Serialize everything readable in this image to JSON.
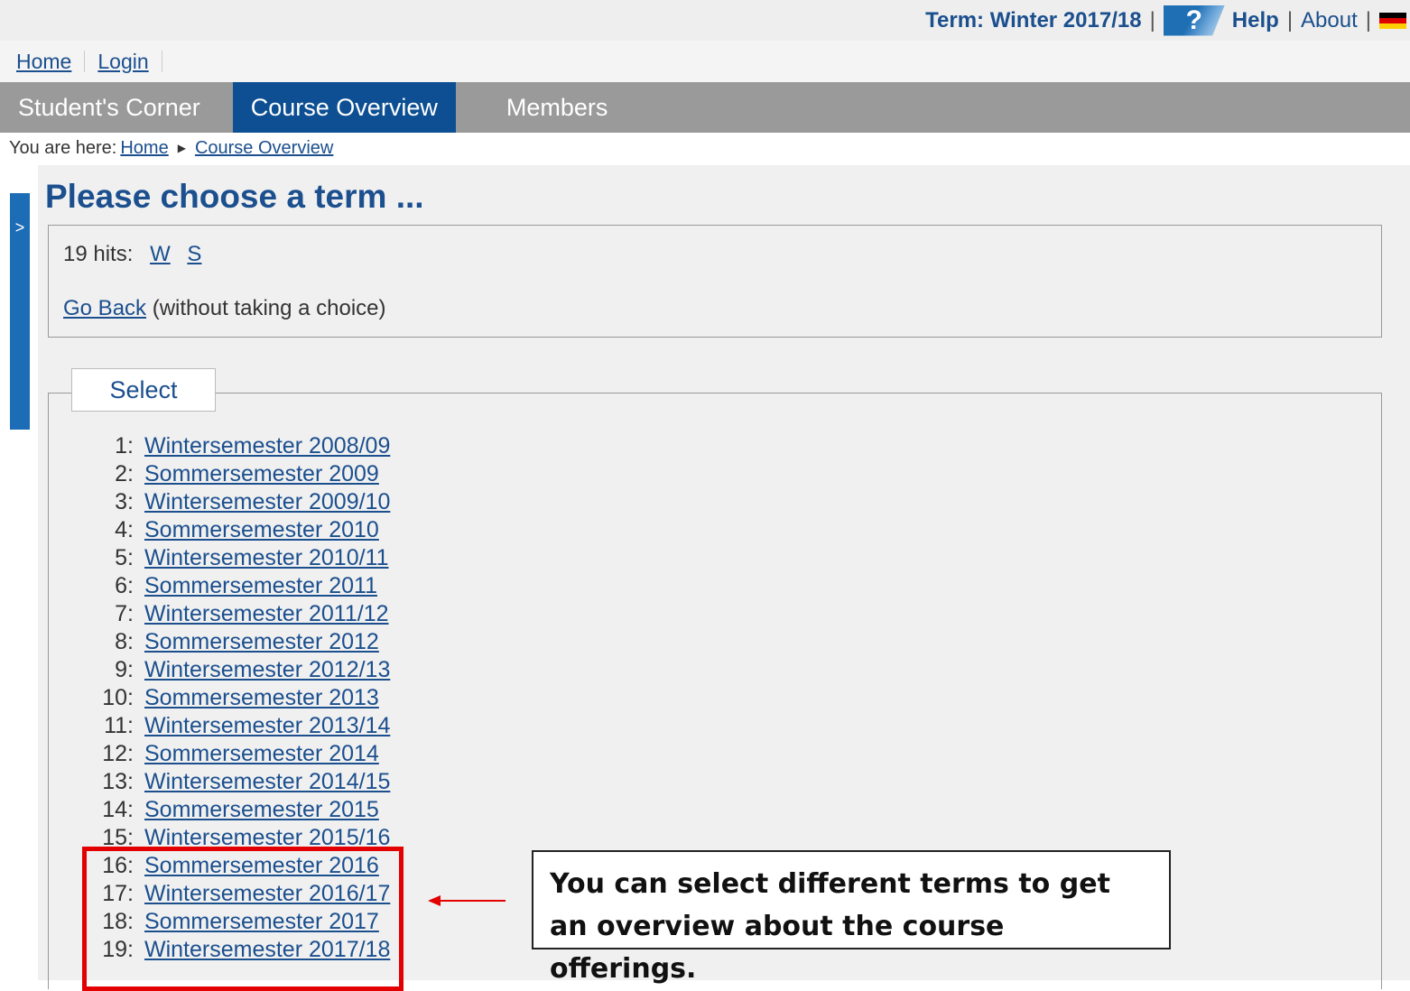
{
  "header": {
    "term_label": "Term: Winter 2017/18",
    "help_label": "Help",
    "about_label": "About"
  },
  "homebar": {
    "home_label": "Home",
    "login_label": "Login"
  },
  "nav": {
    "tabs": [
      {
        "label": "Student's Corner",
        "active": false
      },
      {
        "label": "Course Overview",
        "active": true
      },
      {
        "label": "Members",
        "active": false
      }
    ]
  },
  "breadcrumb": {
    "prefix": "You are here:",
    "items": [
      "Home",
      "Course Overview"
    ]
  },
  "side_tab": {
    "label": ">"
  },
  "main": {
    "title": "Please choose a term ...",
    "hits_label": "19 hits:",
    "filters": [
      "W",
      "S"
    ],
    "go_back_label": "Go Back",
    "go_back_note": "(without taking a choice)",
    "select_legend": "Select",
    "terms": [
      {
        "num": "1:",
        "label": "Wintersemester 2008/09"
      },
      {
        "num": "2:",
        "label": "Sommersemester 2009"
      },
      {
        "num": "3:",
        "label": "Wintersemester 2009/10"
      },
      {
        "num": "4:",
        "label": "Sommersemester 2010"
      },
      {
        "num": "5:",
        "label": "Wintersemester 2010/11"
      },
      {
        "num": "6:",
        "label": "Sommersemester 2011"
      },
      {
        "num": "7:",
        "label": "Wintersemester 2011/12"
      },
      {
        "num": "8:",
        "label": "Sommersemester 2012"
      },
      {
        "num": "9:",
        "label": "Wintersemester 2012/13"
      },
      {
        "num": "10:",
        "label": "Sommersemester 2013"
      },
      {
        "num": "11:",
        "label": "Wintersemester 2013/14"
      },
      {
        "num": "12:",
        "label": "Sommersemester 2014"
      },
      {
        "num": "13:",
        "label": "Wintersemester 2014/15"
      },
      {
        "num": "14:",
        "label": "Sommersemester 2015"
      },
      {
        "num": "15:",
        "label": "Wintersemester 2015/16"
      },
      {
        "num": "16:",
        "label": "Sommersemester 2016"
      },
      {
        "num": "17:",
        "label": "Wintersemester 2016/17"
      },
      {
        "num": "18:",
        "label": "Sommersemester 2017"
      },
      {
        "num": "19:",
        "label": "Wintersemester 2017/18"
      }
    ]
  },
  "annotation": {
    "text": "You can select different terms to get an overview about the course offerings.",
    "highlight_color": "#e20000"
  },
  "colors": {
    "accent": "#0d4f92",
    "nav_bg": "#9a9a9a",
    "link": "#1b4f8e"
  }
}
